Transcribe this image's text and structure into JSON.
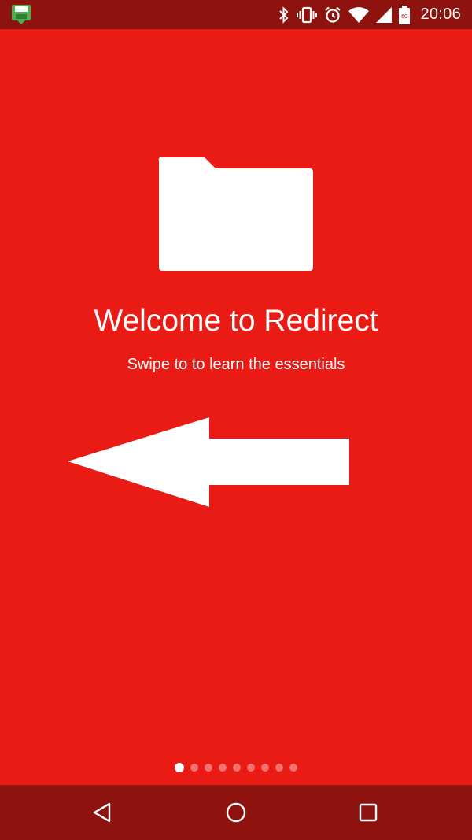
{
  "status_bar": {
    "time": "20:06",
    "battery_level": "60",
    "icons": [
      "save-notification-icon",
      "bluetooth-icon",
      "vibrate-icon",
      "alarm-icon",
      "wifi-icon",
      "cellular-signal-icon",
      "battery-icon"
    ]
  },
  "onboarding": {
    "title": "Welcome to Redirect",
    "subtitle": "Swipe to to learn the essentials",
    "illustrations": [
      "folder-icon",
      "arrow-left-icon"
    ],
    "pages_total": 9,
    "current_page": 1
  },
  "navigation_bar": {
    "buttons": [
      "back",
      "home",
      "recents"
    ]
  },
  "colors": {
    "background": "#E91B14",
    "system_bars": "#8E120D",
    "foreground": "#FFFFFF"
  }
}
